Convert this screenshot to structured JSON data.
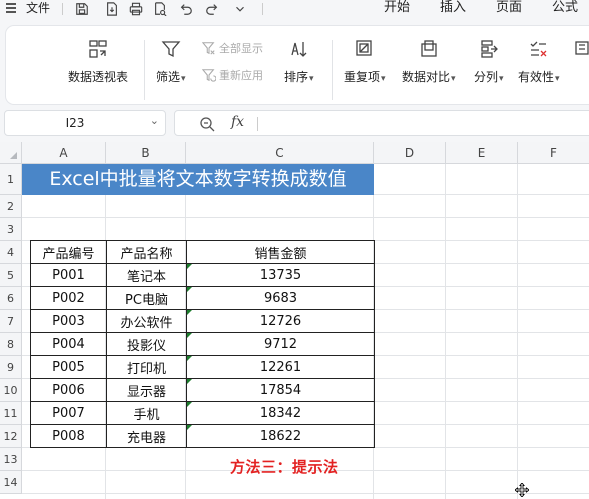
{
  "menubar": {
    "file_label": "文件",
    "tabs": [
      "开始",
      "插入",
      "页面",
      "公式"
    ]
  },
  "ribbon": {
    "pivot_label": "数据透视表",
    "filter_label": "筛选",
    "show_all_label": "全部显示",
    "reapply_label": "重新应用",
    "sort_label": "排序",
    "duplicates_label": "重复项",
    "compare_label": "数据对比",
    "split_label": "分列",
    "validity_label": "有效性"
  },
  "formula_bar": {
    "name_box": "I23",
    "fx_symbol": "fx",
    "formula": ""
  },
  "sheet": {
    "columns": [
      "A",
      "B",
      "C",
      "D",
      "E",
      "F"
    ],
    "rows": [
      "1",
      "2",
      "3",
      "4",
      "5",
      "6",
      "7",
      "8",
      "9",
      "10",
      "11",
      "12",
      "13",
      "14"
    ],
    "title": "Excel中批量将文本数字转换成数值",
    "table": {
      "headers": [
        "产品编号",
        "产品名称",
        "销售金额"
      ],
      "rows": [
        [
          "P001",
          "笔记本",
          "13735"
        ],
        [
          "P002",
          "PC电脑",
          "9683"
        ],
        [
          "P003",
          "办公软件",
          "12726"
        ],
        [
          "P004",
          "投影仪",
          "9712"
        ],
        [
          "P005",
          "打印机",
          "12261"
        ],
        [
          "P006",
          "显示器",
          "17854"
        ],
        [
          "P007",
          "手机",
          "18342"
        ],
        [
          "P008",
          "充电器",
          "18622"
        ]
      ]
    },
    "method_note": "方法三：提示法"
  },
  "colors": {
    "title_bg": "#4a86c8",
    "note_red": "#e32222",
    "error_marker": "#1d7d2e"
  }
}
